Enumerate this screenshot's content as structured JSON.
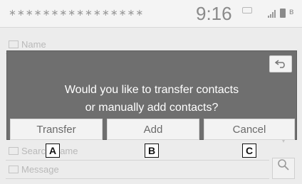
{
  "status_bar": {
    "dots": "∗∗∗∗∗∗∗∗∗∗∗∗∗∗∗∗",
    "time": "9:16"
  },
  "background": {
    "rows": [
      "Name",
      "",
      "",
      "",
      "Search Name",
      "Message"
    ]
  },
  "dialog": {
    "message_line1": "Would you like to transfer contacts",
    "message_line2": "or manually add contacts?",
    "buttons": {
      "transfer": "Transfer",
      "add": "Add",
      "cancel": "Cancel"
    }
  },
  "callouts": {
    "a": "A",
    "b": "B",
    "c": "C"
  },
  "icons": {
    "back": "back-arrow-icon",
    "search": "search-icon",
    "signal": "signal-icon",
    "battery": "battery-icon",
    "bluetooth": "bluetooth-icon"
  },
  "colors": {
    "dialog_bg": "#6f6f6f",
    "button_bg": "#f3f3f3"
  }
}
